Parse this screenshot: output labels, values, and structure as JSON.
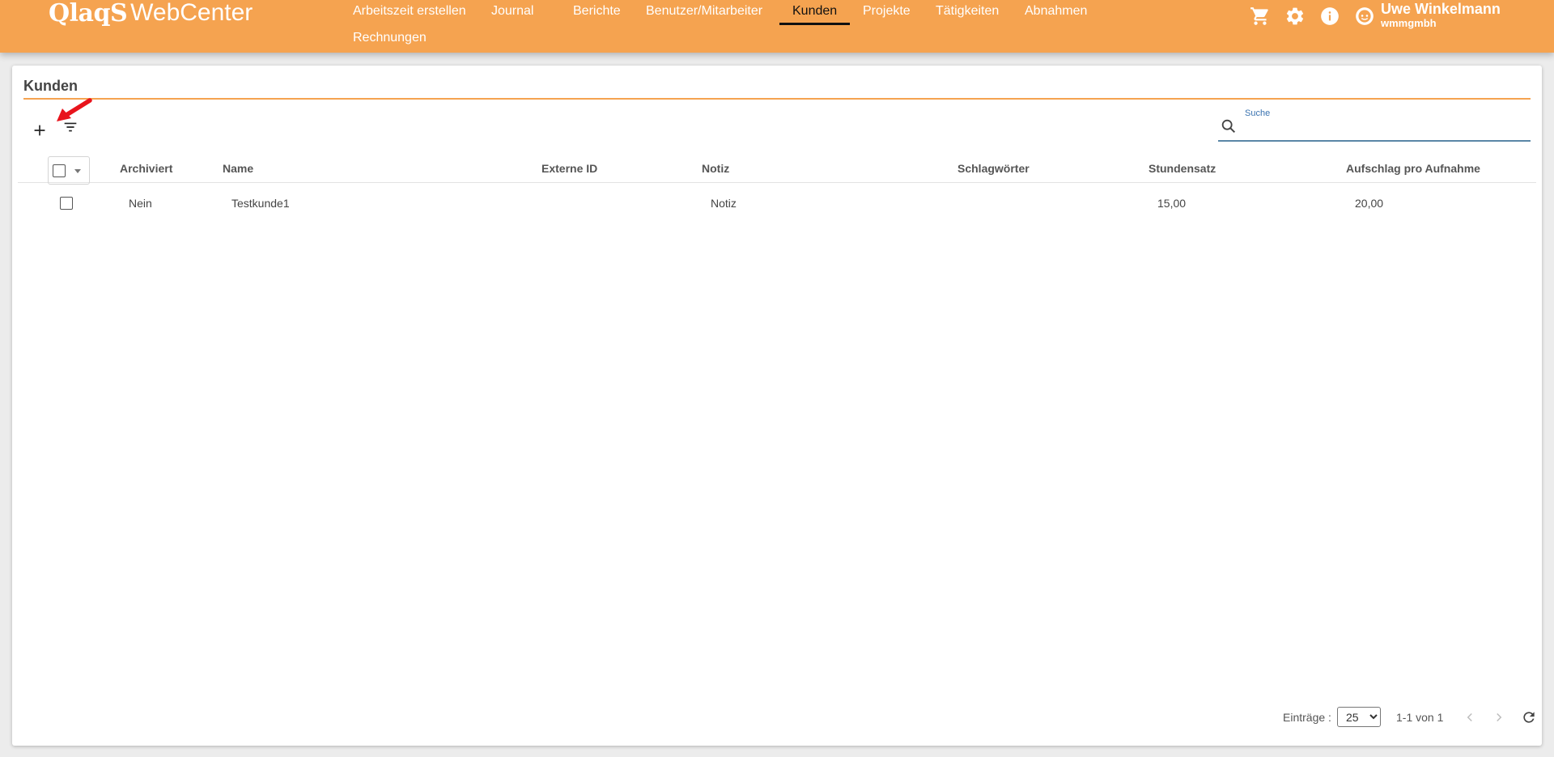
{
  "header": {
    "logo_mark": "QlaqS",
    "logo_text": "WebCenter",
    "nav": [
      {
        "label": "Arbeitszeit erstellen"
      },
      {
        "label": "Journal"
      },
      {
        "label": "Berichte"
      },
      {
        "label": "Benutzer/Mitarbeiter"
      },
      {
        "label": "Kunden",
        "active": true
      },
      {
        "label": "Projekte"
      },
      {
        "label": "Tätigkeiten"
      },
      {
        "label": "Abnahmen"
      },
      {
        "label": "Rechnungen"
      }
    ],
    "icons": [
      "cart-icon",
      "gear-icon",
      "info-icon",
      "avatar-icon"
    ],
    "user": {
      "name": "Uwe Winkelmann",
      "org": "wmmgmbh"
    }
  },
  "page": {
    "title": "Kunden",
    "accent_color": "#f5a350",
    "toolbar": {
      "add_icon": "plus-icon",
      "filter_icon": "filter-icon"
    },
    "search": {
      "label": "Suche",
      "value": ""
    }
  },
  "table": {
    "columns": [
      "Archiviert",
      "Name",
      "Externe ID",
      "Notiz",
      "Schlagwörter",
      "Stundensatz",
      "Aufschlag pro Aufnahme"
    ],
    "rows": [
      {
        "archiviert": "Nein",
        "name": "Testkunde1",
        "externe_id": "",
        "notiz": "Notiz",
        "schlagwoerter": "",
        "stundensatz": "15,00",
        "aufschlag": "20,00"
      }
    ]
  },
  "paging": {
    "entries_label": "Einträge :",
    "page_size": "25",
    "page_size_options": [
      "25"
    ],
    "range": "1-1 von 1"
  }
}
